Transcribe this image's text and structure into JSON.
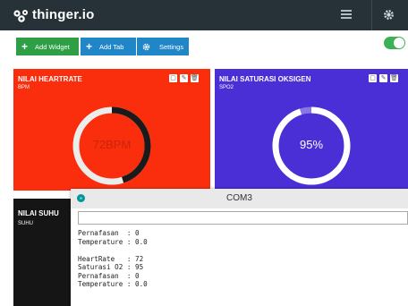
{
  "app": {
    "brand": "thinger.io",
    "logo_icon": "thinger-logo-icon",
    "menu_icon": "menu-icon",
    "settings_icon": "gear-icon"
  },
  "toolbar": {
    "add_widget_label": "Add Widget",
    "add_tab_label": "Add Tab",
    "settings_label": "Settings",
    "add_widget_icon": "+",
    "add_tab_icon": "+",
    "settings_icon": "gear-icon",
    "toggle_on": true
  },
  "widgets": {
    "heartrate": {
      "title": "NILAI HEARTRATE",
      "subtitle": "BPM",
      "value_text": "72BPM",
      "value": 72,
      "gauge_fraction": 0.45,
      "color": "#fa2d0d"
    },
    "spo2": {
      "title": "NILAI SATURASI OKSIGEN",
      "subtitle": "SPO2",
      "value_text": "95%",
      "value": 95,
      "gauge_fraction": 0.95,
      "color": "#4a2fd6"
    },
    "suhu": {
      "title": "NILAI SUHU",
      "subtitle": "SUHU"
    }
  },
  "serial_monitor": {
    "title": "COM3",
    "input_value": "",
    "lines": [
      "Pernafasan  : 0",
      "Temperature : 0.0",
      "",
      "HeartRate   : 72",
      "Saturasi O2 : 95",
      "Pernafasan  : 0",
      "Temperature : 0.0"
    ]
  },
  "colors": {
    "topbar": "#263238",
    "green": "#2e9f45",
    "blue": "#1f86c8",
    "toggle": "#3cb054"
  }
}
